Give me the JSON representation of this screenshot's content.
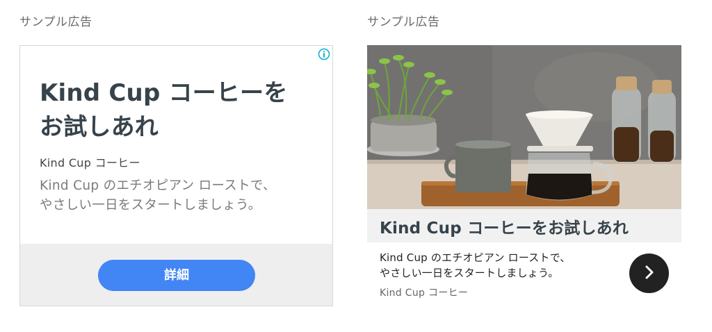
{
  "labels": {
    "left": "サンプル広告",
    "right": "サンプル広告"
  },
  "ad_left": {
    "headline_line1": "Kind Cup コーヒーを",
    "headline_line2": "お試しあれ",
    "advertiser": "Kind Cup コーヒー",
    "description_line1": "Kind Cup のエチオピアン ローストで、",
    "description_line2": "やさしい一日をスタートしましょう。",
    "button_label": "詳細",
    "info_icon": "info-icon",
    "colors": {
      "button": "#4285f4",
      "footer": "#eeeeee",
      "info": "#00aecd"
    }
  },
  "ad_right": {
    "image": "coffee-photo",
    "title": "Kind Cup コーヒーをお試しあれ",
    "description_line1": "Kind Cup のエチオピアン ローストで、",
    "description_line2": "やさしい一日をスタートしましょう。",
    "advertiser": "Kind Cup コーヒー",
    "next_icon": "chevron-right-icon",
    "colors": {
      "title_bar": "#f1f1f1",
      "next_button": "#222222"
    }
  }
}
